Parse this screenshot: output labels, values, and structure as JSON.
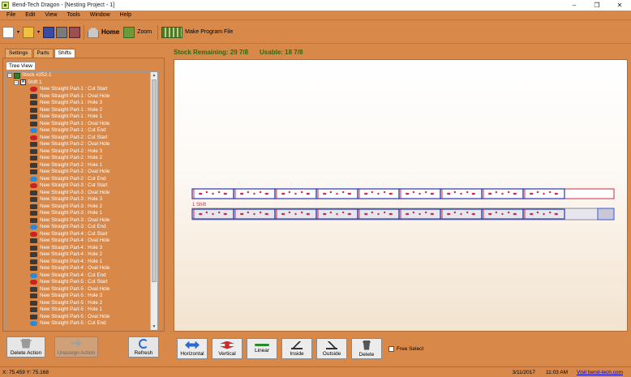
{
  "window": {
    "title": "Bend-Tech Dragon - [Nesting Project - 1]",
    "controls": {
      "minimize": "–",
      "maximize": "❐",
      "close": "✕"
    }
  },
  "menu": [
    "File",
    "Edit",
    "View",
    "Tools",
    "Window",
    "Help"
  ],
  "toolbar": {
    "home_label": "Home",
    "zoom_label": "Zoom",
    "make_program_label": "Make Program File",
    "dropdown_glyph": "▾"
  },
  "left_panel": {
    "tabs": [
      "Settings",
      "Parts",
      "Shifts"
    ],
    "active_tab": "Shifts",
    "subtab": "Tree View",
    "tree": {
      "stock_label": "Stock #252-1",
      "shift_label": "Shift 1",
      "actions": [
        {
          "label": "New Straight Part-1 : Cut Start",
          "kind": "start"
        },
        {
          "label": "New Straight Part-1 : Oval Hole",
          "kind": "hole"
        },
        {
          "label": "New Straight Part-1 : Hole 3",
          "kind": "hole"
        },
        {
          "label": "New Straight Part-1 : Hole 2",
          "kind": "hole"
        },
        {
          "label": "New Straight Part-1 : Hole 1",
          "kind": "hole"
        },
        {
          "label": "New Straight Part-1 : Oval Hole",
          "kind": "hole"
        },
        {
          "label": "New Straight Part-1 : Cut End",
          "kind": "end"
        },
        {
          "label": "New Straight Part-2 : Cut Start",
          "kind": "start"
        },
        {
          "label": "New Straight Part-2 : Oval Hole",
          "kind": "hole"
        },
        {
          "label": "New Straight Part-2 : Hole 3",
          "kind": "hole"
        },
        {
          "label": "New Straight Part-2 : Hole 2",
          "kind": "hole"
        },
        {
          "label": "New Straight Part-2 : Hole 1",
          "kind": "hole"
        },
        {
          "label": "New Straight Part-2 : Oval Hole",
          "kind": "hole"
        },
        {
          "label": "New Straight Part-2 : Cut End",
          "kind": "end"
        },
        {
          "label": "New Straight Part-3 : Cut Start",
          "kind": "start"
        },
        {
          "label": "New Straight Part-3 : Oval Hole",
          "kind": "hole"
        },
        {
          "label": "New Straight Part-3 : Hole 3",
          "kind": "hole"
        },
        {
          "label": "New Straight Part-3 : Hole 2",
          "kind": "hole"
        },
        {
          "label": "New Straight Part-3 : Hole 1",
          "kind": "hole"
        },
        {
          "label": "New Straight Part-3 : Oval Hole",
          "kind": "hole"
        },
        {
          "label": "New Straight Part-3 : Cut End",
          "kind": "end"
        },
        {
          "label": "New Straight Part-4 : Cut Start",
          "kind": "start"
        },
        {
          "label": "New Straight Part-4 : Oval Hole",
          "kind": "hole"
        },
        {
          "label": "New Straight Part-4 : Hole 3",
          "kind": "hole"
        },
        {
          "label": "New Straight Part-4 : Hole 2",
          "kind": "hole"
        },
        {
          "label": "New Straight Part-4 : Hole 1",
          "kind": "hole"
        },
        {
          "label": "New Straight Part-4 : Oval Hole",
          "kind": "hole"
        },
        {
          "label": "New Straight Part-4 : Cut End",
          "kind": "end"
        },
        {
          "label": "New Straight Part-5 : Cut Start",
          "kind": "start"
        },
        {
          "label": "New Straight Part-5 : Oval Hole",
          "kind": "hole"
        },
        {
          "label": "New Straight Part-5 : Hole 3",
          "kind": "hole"
        },
        {
          "label": "New Straight Part-5 : Hole 2",
          "kind": "hole"
        },
        {
          "label": "New Straight Part-5 : Hole 1",
          "kind": "hole"
        },
        {
          "label": "New Straight Part-5 : Oval Hole",
          "kind": "hole"
        },
        {
          "label": "New Straight Part-5 : Cut End",
          "kind": "end"
        }
      ]
    },
    "buttons": {
      "delete_action": "Delete Action",
      "unassign_action": "Unassign Action",
      "refresh": "Refresh"
    }
  },
  "right_panel": {
    "stock_remaining": "Stock Remaining: 29 7/8",
    "usable": "Usable: 18 7/8",
    "shift_label": "1 Shift",
    "colors": {
      "stock_outline": "#cc2a4a",
      "part_outline": "#2a3ab0",
      "shift_fill": "#e6e6ec",
      "end_marker": "#3a5ad0"
    },
    "buttons": [
      "Horizontal",
      "Vertical",
      "Linear",
      "Inside",
      "Outside",
      "Delete"
    ],
    "free_select_label": "Free Select"
  },
  "status": {
    "coords": "X: 75.459  Y: 75.168",
    "date": "3/11/2017",
    "time": "11:03 AM",
    "link": "Visit bend-tech.com"
  }
}
